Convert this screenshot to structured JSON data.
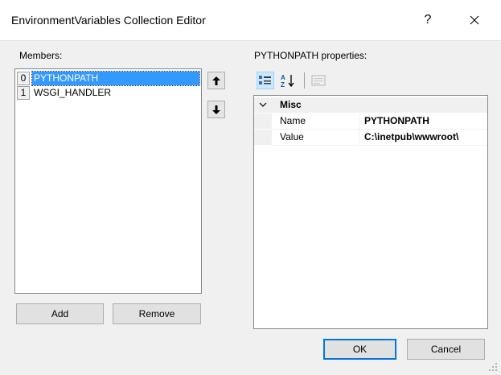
{
  "window": {
    "title": "EnvironmentVariables Collection Editor",
    "help_label": "?"
  },
  "members": {
    "label": "Members:",
    "items": [
      {
        "index": "0",
        "name": "PYTHONPATH",
        "selected": true
      },
      {
        "index": "1",
        "name": "WSGI_HANDLER",
        "selected": false
      }
    ],
    "add_label": "Add",
    "remove_label": "Remove"
  },
  "properties": {
    "label": "PYTHONPATH properties:",
    "category": "Misc",
    "rows": [
      {
        "name": "Name",
        "value": "PYTHONPATH"
      },
      {
        "name": "Value",
        "value": "C:\\inetpub\\wwwroot\\"
      }
    ]
  },
  "footer": {
    "ok_label": "OK",
    "cancel_label": "Cancel"
  },
  "colors": {
    "selection": "#3399ff",
    "default_button_border": "#0078d7"
  }
}
